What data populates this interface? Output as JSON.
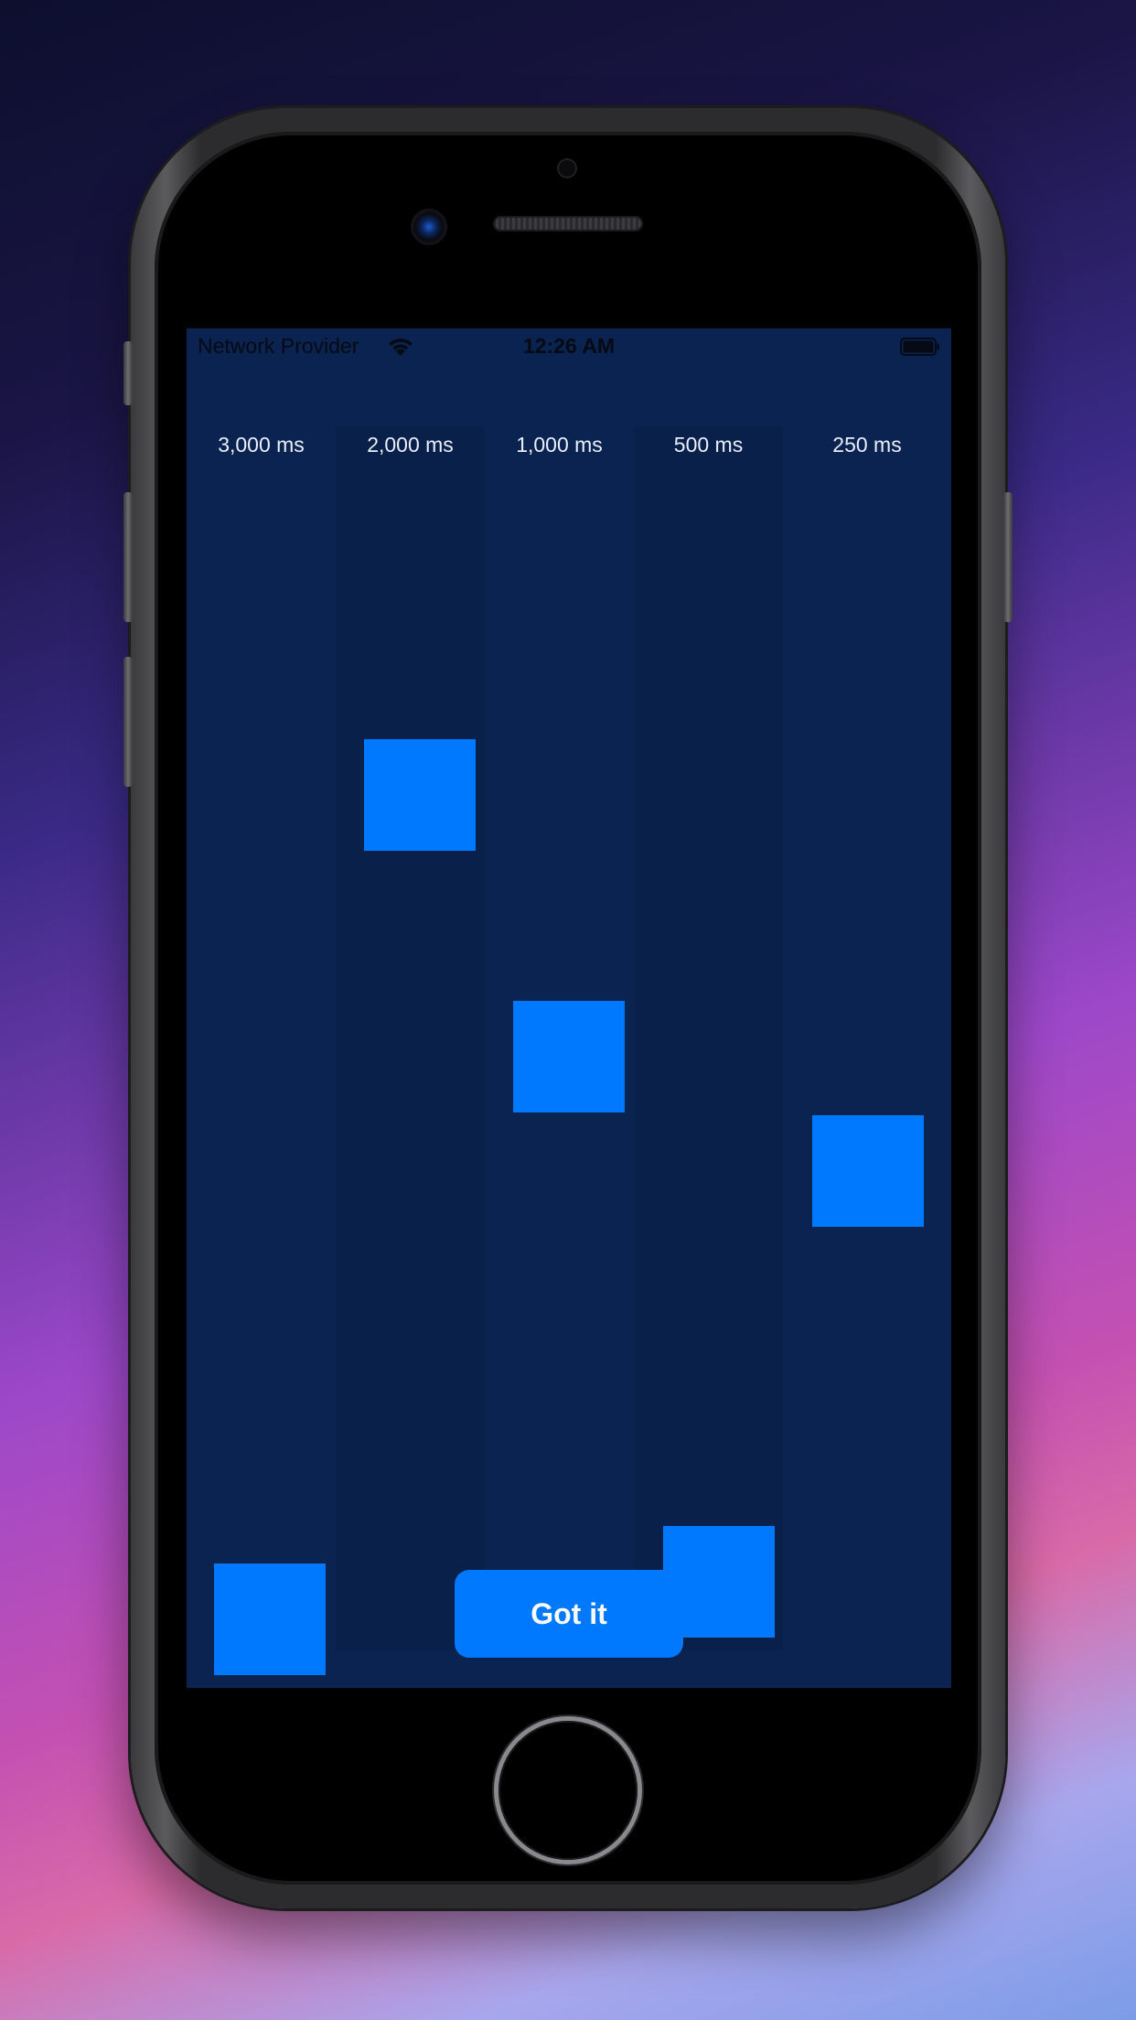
{
  "status_bar": {
    "carrier": "Network Provider",
    "time": "12:26 AM",
    "wifi_icon": "wifi-icon",
    "battery_icon": "battery-icon"
  },
  "columns": [
    {
      "label": "3,000 ms"
    },
    {
      "label": "2,000 ms"
    },
    {
      "label": "1,000 ms"
    },
    {
      "label": "500 ms"
    },
    {
      "label": "250 ms"
    }
  ],
  "button": {
    "label": "Got it"
  },
  "colors": {
    "accent": "#0079ff",
    "screen_background": "#0a2350",
    "column_shade": "#09204a"
  }
}
